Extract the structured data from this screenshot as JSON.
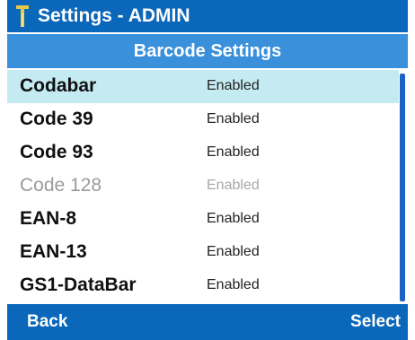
{
  "status_bar": {
    "title": "Settings - ADMIN",
    "icon": "antenna-icon"
  },
  "header": {
    "title": "Barcode Settings"
  },
  "list": {
    "items": [
      {
        "name": "Codabar",
        "state": "Enabled"
      },
      {
        "name": "Code 39",
        "state": "Enabled"
      },
      {
        "name": "Code 93",
        "state": "Enabled"
      },
      {
        "name": "Code 128",
        "state": "Enabled"
      },
      {
        "name": "EAN-8",
        "state": "Enabled"
      },
      {
        "name": "EAN-13",
        "state": "Enabled"
      },
      {
        "name": "GS1-DataBar",
        "state": "Enabled"
      }
    ],
    "selected_index": 0,
    "dimmed_index": 3
  },
  "softkeys": {
    "left": "Back",
    "right": "Select"
  },
  "colors": {
    "status_bar": "#0b67b9",
    "header": "#3a90db",
    "selected_row": "#c5ebf2",
    "scrollbar": "#1b62c4"
  }
}
